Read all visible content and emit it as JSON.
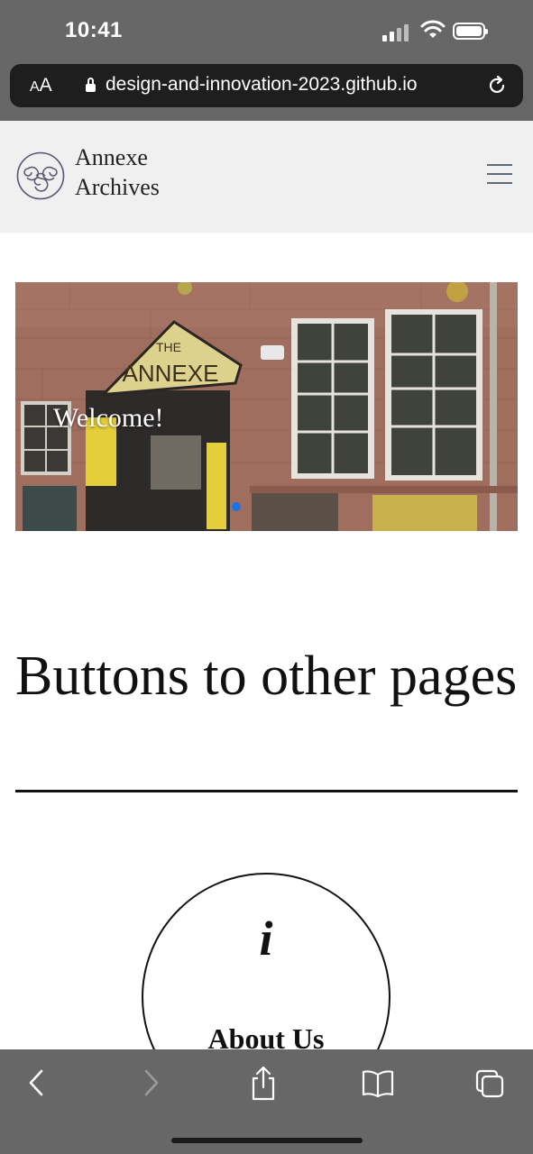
{
  "status": {
    "time": "10:41"
  },
  "browser": {
    "aa_small": "A",
    "aa_large": "A",
    "url": "design-and-innovation-2023.github.io"
  },
  "site": {
    "brand_line1": "Annexe",
    "brand_line2": "Archives",
    "carousel": {
      "caption": "Welcome!",
      "sign_top": "THE",
      "sign_main": "ANNEXE",
      "active_slide": 1
    },
    "heading": "Buttons to other pages",
    "about": {
      "icon_glyph": "i",
      "label": "About Us"
    }
  },
  "colors": {
    "chrome": "#676767",
    "accent": "#1a73e8",
    "navbar": "#f0f0f0"
  },
  "icons": [
    "lock-icon",
    "reload-icon",
    "menu-icon",
    "back-icon",
    "forward-icon",
    "share-icon",
    "bookmarks-icon",
    "tabs-icon"
  ]
}
